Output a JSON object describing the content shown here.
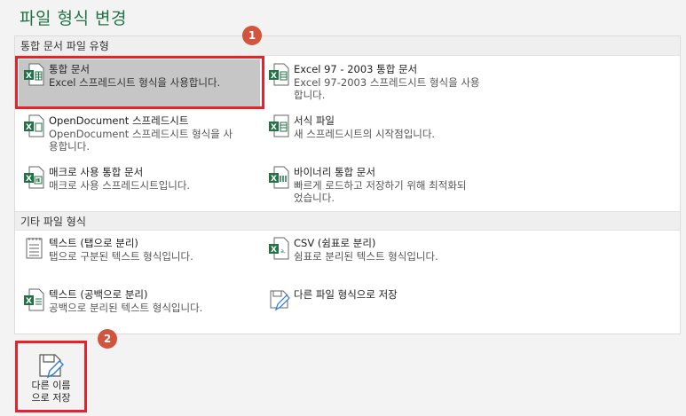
{
  "page": {
    "title": "파일 형식 변경"
  },
  "sections": {
    "workbook_types": {
      "header": "통합 문서 파일 유형"
    },
    "other_types": {
      "header": "기타 파일 형식"
    }
  },
  "items": {
    "workbook": {
      "name": "통합 문서",
      "desc": "Excel 스프레드시트 형식을 사용합니다."
    },
    "excel97": {
      "name": "Excel 97 - 2003 통합 문서",
      "desc1": "Excel 97-2003 스프레드시트 형식을 사용",
      "desc2": "합니다."
    },
    "ods": {
      "name": "OpenDocument 스프레드시트",
      "desc1": "OpenDocument 스프레드시트 형식을 사",
      "desc2": "용합니다."
    },
    "template": {
      "name": "서식 파일",
      "desc": "새 스프레드시트의 시작점입니다."
    },
    "macro": {
      "name": "매크로 사용 통합 문서",
      "desc": "매크로 사용 스프레드시트입니다."
    },
    "binary": {
      "name": "바이너리 통합 문서",
      "desc1": "빠르게 로드하고 저장하기 위해 최적화되",
      "desc2": "었습니다."
    },
    "text_tab": {
      "name": "텍스트 (탭으로 분리)",
      "desc": "탭으로 구분된 텍스트 형식입니다."
    },
    "csv": {
      "name": "CSV (쉼표로 분리)",
      "desc": "쉼표로 분리된 텍스트 형식입니다."
    },
    "text_space": {
      "name": "텍스트 (공백으로 분리)",
      "desc": "공백으로 분리된 텍스트 형식입니다."
    },
    "other_format": {
      "name": "다른 파일 형식으로 저장"
    }
  },
  "badges": {
    "one": "1",
    "two": "2"
  },
  "save_as": {
    "line1": "다른 이름",
    "line2": "으로 저장"
  },
  "colors": {
    "accent": "#217346",
    "highlight": "#e8222a",
    "badge": "#d2543c",
    "selected": "#c6c6c6"
  }
}
